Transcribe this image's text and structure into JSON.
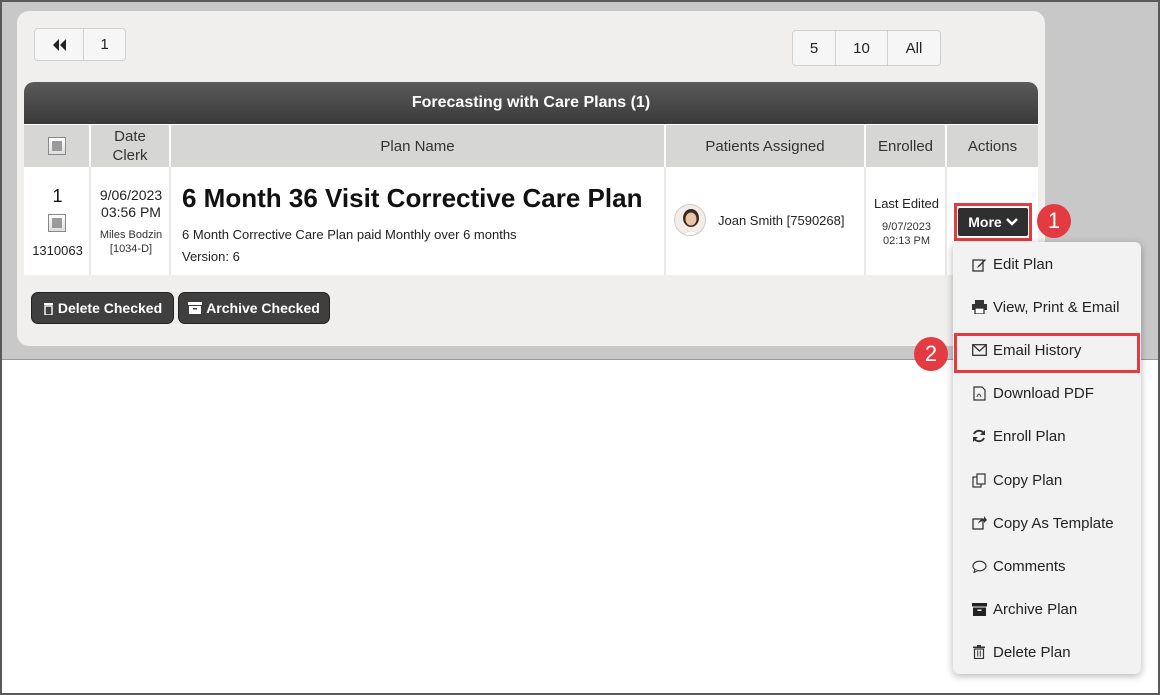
{
  "pagination": {
    "first_label": "",
    "current_page": "1",
    "page_sizes": [
      "5",
      "10",
      "All"
    ]
  },
  "table": {
    "title": "Forecasting with Care Plans (1)",
    "headers": {
      "date": "Date",
      "clerk": "Clerk",
      "plan_name": "Plan Name",
      "patients": "Patients Assigned",
      "enrolled": "Enrolled",
      "actions": "Actions"
    },
    "row": {
      "number": "1",
      "id": "1310063",
      "date": "9/06/2023",
      "time": "03:56 PM",
      "clerk_name": "Miles Bodzin",
      "clerk_code": "[1034-D]",
      "plan_name": "6 Month 36 Visit Corrective Care Plan",
      "plan_desc": "6 Month Corrective Care Plan paid Monthly over 6 months",
      "plan_version": "Version: 6",
      "patient": "Joan Smith [7590268]",
      "enrolled_label": "Last Edited",
      "enrolled_date": "9/07/2023",
      "enrolled_time": "02:13 PM",
      "more_label": "More"
    }
  },
  "bulk_actions": {
    "delete_label": "Delete Checked",
    "archive_label": "Archive Checked"
  },
  "steps": [
    "1",
    "2"
  ],
  "menu": [
    {
      "label": "Edit Plan",
      "icon": "edit-icon"
    },
    {
      "label": "View, Print & Email",
      "icon": "print-icon"
    },
    {
      "label": "Email History",
      "icon": "envelope-icon"
    },
    {
      "label": "Download PDF",
      "icon": "pdf-icon"
    },
    {
      "label": "Enroll Plan",
      "icon": "refresh-icon"
    },
    {
      "label": "Copy Plan",
      "icon": "copy-icon"
    },
    {
      "label": "Copy As Template",
      "icon": "share-icon"
    },
    {
      "label": "Comments",
      "icon": "comment-icon"
    },
    {
      "label": "Archive Plan",
      "icon": "archive-icon"
    },
    {
      "label": "Delete Plan",
      "icon": "trash-icon"
    }
  ],
  "colors": {
    "highlight": "#e23b42",
    "header_dark": "#3a3a3a",
    "panel": "#f0efed"
  }
}
